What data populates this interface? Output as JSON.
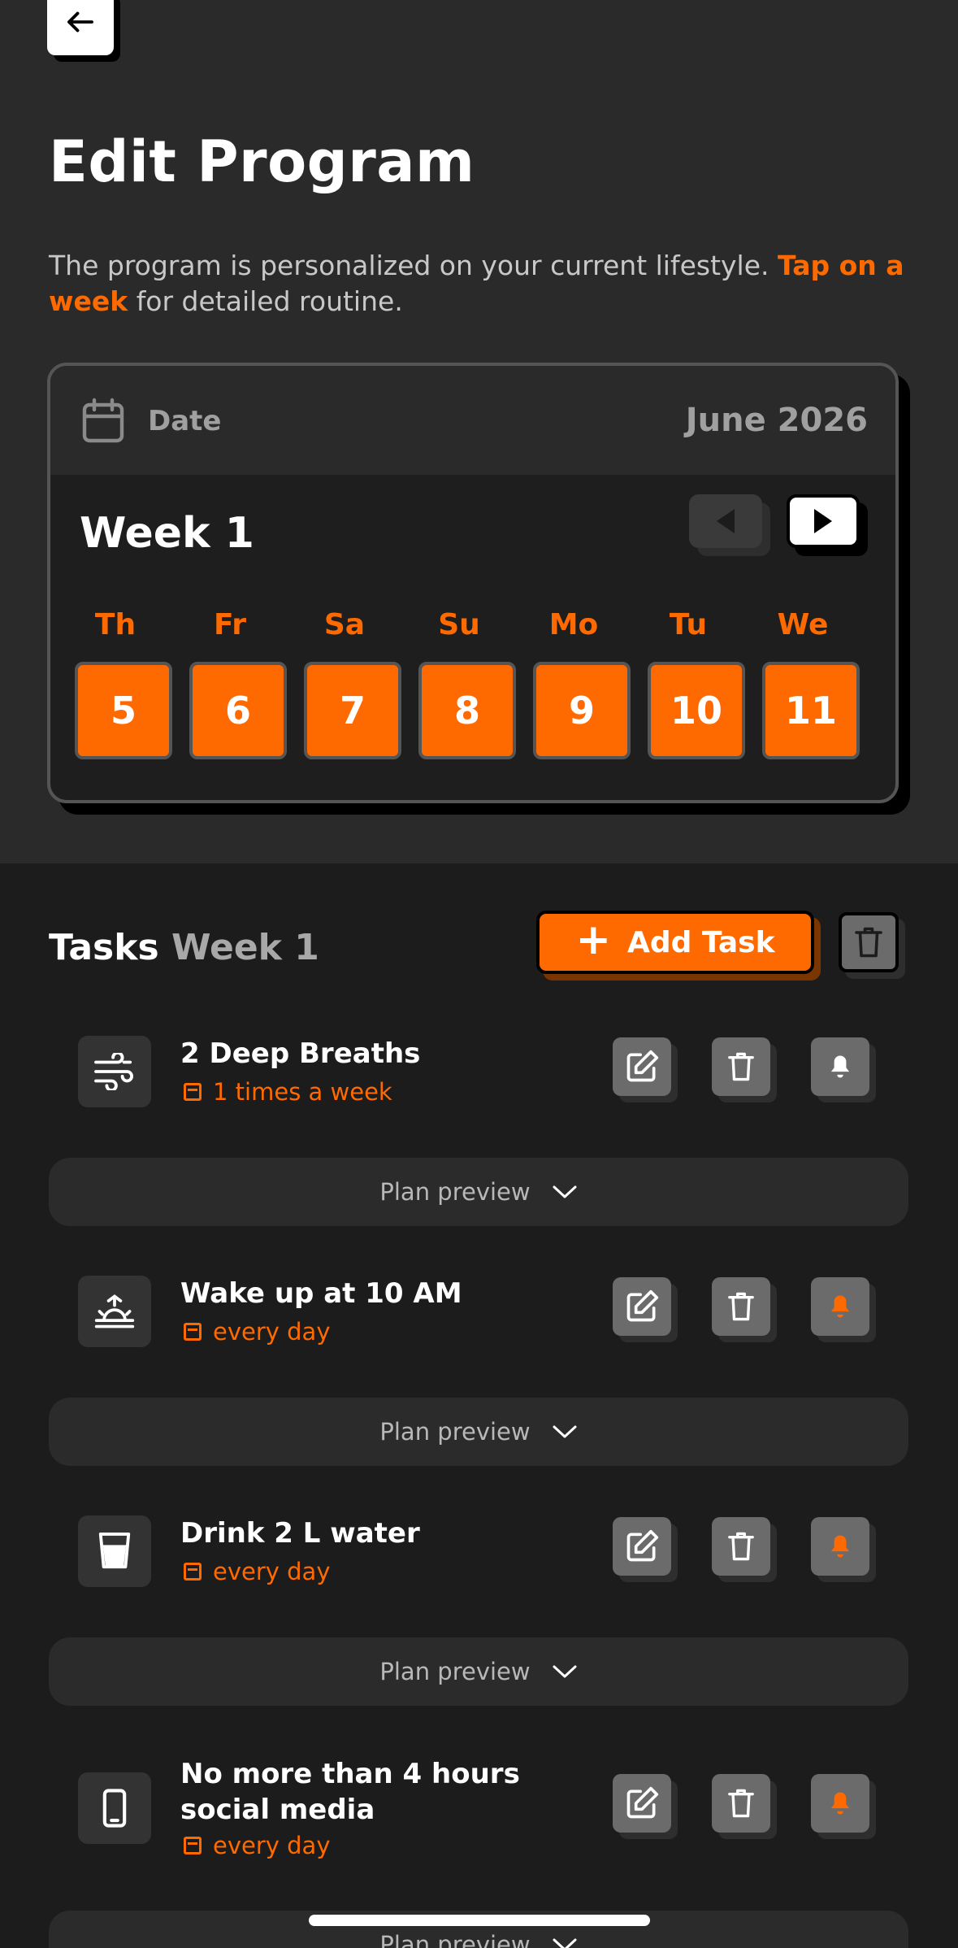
{
  "header": {
    "back_icon": "arrow-left-icon",
    "title": "Edit Program",
    "subtitle_text": "The program is personalized on your current lifestyle. ",
    "subtitle_accent": "Tap on a week",
    "subtitle_tail": " for detailed routine."
  },
  "date_card": {
    "icon": "calendar-icon",
    "label": "Date",
    "month": "June 2026",
    "week_title": "Week 1",
    "prev_icon": "caret-left-icon",
    "next_icon": "caret-right-icon",
    "days": [
      {
        "name": "Th",
        "num": "5"
      },
      {
        "name": "Fr",
        "num": "6"
      },
      {
        "name": "Sa",
        "num": "7"
      },
      {
        "name": "Su",
        "num": "8"
      },
      {
        "name": "Mo",
        "num": "9"
      },
      {
        "name": "Tu",
        "num": "10"
      },
      {
        "name": "We",
        "num": "11"
      }
    ]
  },
  "tasks": {
    "title": "Tasks",
    "title_week": "Week 1",
    "add_label": "Add Task",
    "items": [
      {
        "name": "2 Deep Breaths",
        "freq": "1 times a week",
        "icon": "wind-icon",
        "bell_active": false
      },
      {
        "name": "Wake up at 10 AM",
        "freq": "every day",
        "icon": "sunrise-icon",
        "bell_active": true
      },
      {
        "name": "Drink 2 L water",
        "freq": "every day",
        "icon": "glass-icon",
        "bell_active": true
      },
      {
        "name": "No more than 4 hours",
        "name2": "social media",
        "freq": "every day",
        "icon": "phone-icon",
        "bell_active": true
      }
    ],
    "plan_preview_label": "Plan preview"
  },
  "colors": {
    "accent": "#ff6a00",
    "background": "#1c1c1c",
    "surface": "#2a2a2a"
  }
}
